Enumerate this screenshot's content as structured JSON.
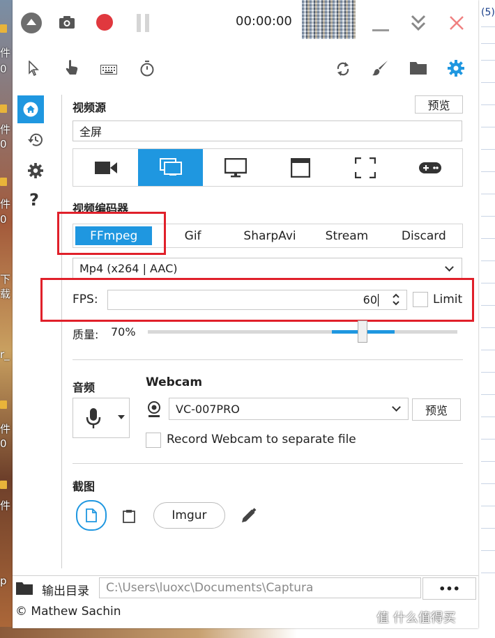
{
  "desktop": {
    "left_labels": [
      "件",
      "0",
      "件",
      "0",
      "件",
      "0",
      "下载",
      "r_",
      "件",
      "0",
      "件",
      "p"
    ],
    "right_label": "(5)"
  },
  "titlebar": {
    "timer": "00:00:00",
    "icons": [
      "menu-icon",
      "camera-icon",
      "record-icon",
      "pause-icon",
      "minimize-icon",
      "collapse-icon",
      "close-icon"
    ]
  },
  "toolbar": {
    "icons": [
      "pointer-icon",
      "click-hand-icon",
      "keyboard-icon",
      "timer-icon",
      "refresh-icon",
      "brush-icon",
      "folder-icon",
      "settings-icon"
    ]
  },
  "sidebar": {
    "icons": [
      "home-icon",
      "history-icon",
      "gear-icon",
      "help-icon"
    ],
    "help_glyph": "?"
  },
  "video_source": {
    "title": "视频源",
    "preview_label": "预览",
    "value": "全屏",
    "source_icons": [
      "webcam-icon",
      "screen-icon",
      "monitor-icon",
      "window-icon",
      "region-icon",
      "gamepad-icon"
    ],
    "selected_index": 1
  },
  "video_encoder": {
    "title": "视频编码器",
    "tabs": [
      "FFmpeg",
      "Gif",
      "SharpAvi",
      "Stream",
      "Discard"
    ],
    "selected_tab": 0,
    "codec": "Mp4 (x264 | AAC)",
    "fps_label": "FPS:",
    "fps_value": "60",
    "limit_label": "Limit",
    "quality_label": "质量:",
    "quality_value": "70%",
    "quality_fraction": 0.7
  },
  "audio": {
    "title": "音频"
  },
  "webcam": {
    "title": "Webcam",
    "device": "VC-007PRO",
    "preview_label": "预览",
    "separate_file_label": "Record Webcam to separate file"
  },
  "screenshot": {
    "title": "截图",
    "imgur_label": "Imgur"
  },
  "status_bar": {
    "output_label": "输出目录",
    "output_path": "C:\\Users\\luoxc\\Documents\\Captura",
    "more_label": "•••"
  },
  "footer": {
    "copyright": "© Mathew Sachin"
  },
  "watermark": {
    "text": "值 什么值得买"
  },
  "colors": {
    "accent": "#1f97e0",
    "record": "#e0383e",
    "close": "#f08080",
    "annotation": "#e0202a"
  }
}
